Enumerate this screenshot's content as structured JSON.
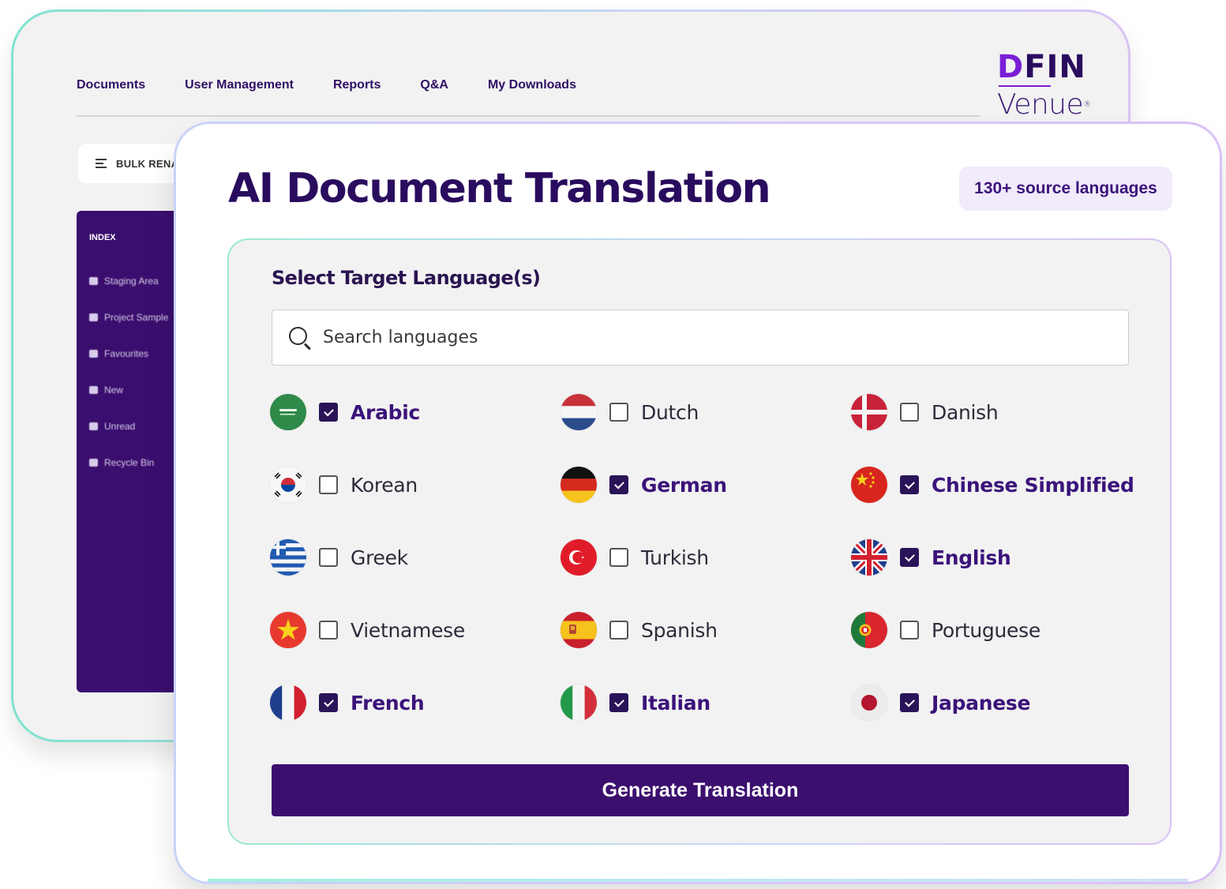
{
  "back_window": {
    "nav": [
      "Documents",
      "User Management",
      "Reports",
      "Q&A",
      "My Downloads"
    ],
    "logo": {
      "top": "DFIN",
      "bottom": "Venue",
      "mark": "®"
    },
    "bulk_button_label": "BULK RENA",
    "bulk_icon": "list-icon",
    "index": {
      "title": "INDEX",
      "items": [
        "Staging Area",
        "Project Sample",
        "Favourites",
        "New",
        "Unread",
        "Recycle Bin"
      ]
    }
  },
  "card": {
    "title": "AI Document Translation",
    "badge": "130+ source languages",
    "panel": {
      "heading": "Select Target Language(s)",
      "search": {
        "placeholder": "Search languages",
        "value": "",
        "icon": "search-icon"
      },
      "languages": [
        {
          "label": "Arabic",
          "checked": true,
          "flag": "saudi-arabia"
        },
        {
          "label": "Dutch",
          "checked": false,
          "flag": "netherlands"
        },
        {
          "label": "Danish",
          "checked": false,
          "flag": "denmark"
        },
        {
          "label": "Korean",
          "checked": false,
          "flag": "south-korea"
        },
        {
          "label": "German",
          "checked": true,
          "flag": "germany"
        },
        {
          "label": "Chinese Simplified",
          "checked": true,
          "flag": "china"
        },
        {
          "label": "Greek",
          "checked": false,
          "flag": "greece"
        },
        {
          "label": "Turkish",
          "checked": false,
          "flag": "turkey"
        },
        {
          "label": "English",
          "checked": true,
          "flag": "united-kingdom"
        },
        {
          "label": "Vietnamese",
          "checked": false,
          "flag": "vietnam"
        },
        {
          "label": "Spanish",
          "checked": false,
          "flag": "spain"
        },
        {
          "label": "Portuguese",
          "checked": false,
          "flag": "portugal"
        },
        {
          "label": "French",
          "checked": true,
          "flag": "france"
        },
        {
          "label": "Italian",
          "checked": true,
          "flag": "italy"
        },
        {
          "label": "Japanese",
          "checked": true,
          "flag": "japan"
        }
      ],
      "generate_label": "Generate Translation"
    }
  },
  "colors": {
    "brand_purple": "#3b0f6e",
    "title_purple": "#2a0c5e",
    "accent_violet": "#7a1fd6",
    "badge_bg": "#f1ebfb",
    "panel_bg": "#f2f2f2"
  }
}
